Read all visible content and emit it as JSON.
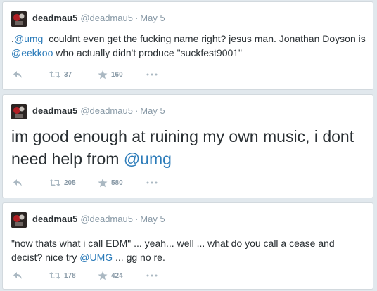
{
  "tweets": [
    {
      "name": "deadmau5",
      "handle": "@deadmau5",
      "date": "May 5",
      "text_before": ".",
      "mention1": "@umg",
      "text_mid": "  couldnt even get the fucking name right? jesus man. Jonathan Doyson is ",
      "mention2": "@eekkoo",
      "text_after": " who actually didn't produce \"suckfest9001\"",
      "retweets": "37",
      "favorites": "160"
    },
    {
      "name": "deadmau5",
      "handle": "@deadmau5",
      "date": "May 5",
      "text_before": "im good enough at ruining my own music, i dont need help from ",
      "mention1": "@umg",
      "retweets": "205",
      "favorites": "580"
    },
    {
      "name": "deadmau5",
      "handle": "@deadmau5",
      "date": "May 5",
      "text_before": "\"now thats what i call EDM\" ... yeah... well ... what do you call a cease and decist? nice try ",
      "mention1": "@UMG",
      "text_after": " ... gg no re.",
      "retweets": "178",
      "favorites": "424"
    }
  ],
  "separator": "·",
  "icons": {
    "reply": "reply-icon",
    "retweet": "retweet-icon",
    "favorite": "star-icon",
    "more": "more-icon"
  },
  "colors": {
    "link": "#2b7bb9",
    "muted": "#8899a6",
    "text": "#292f33"
  }
}
